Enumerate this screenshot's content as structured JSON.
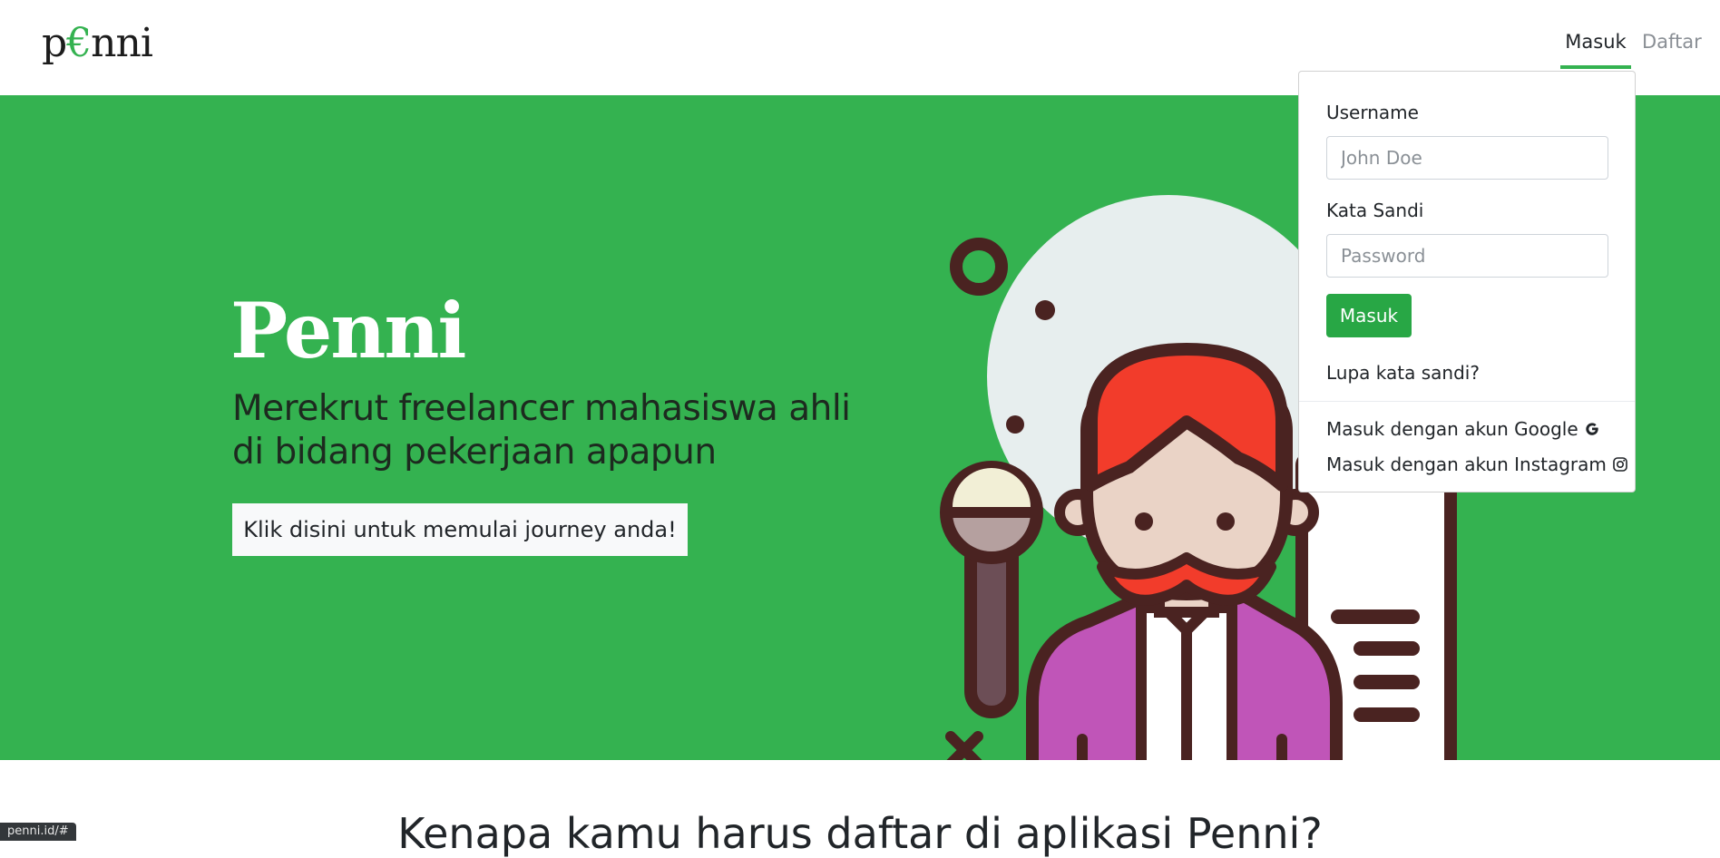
{
  "navbar": {
    "brand_prefix": "p",
    "brand_euro": "€",
    "brand_suffix": "nni",
    "login_label": "Masuk",
    "register_label": "Daftar",
    "accent_color": "#34b250"
  },
  "hero": {
    "title": "Penni",
    "subtitle": "Merekrut freelancer mahasiswa ahli di bidang pekerjaan apapun",
    "cta_label": "Klik disini untuk memulai journey anda!",
    "background_color": "#34b250"
  },
  "login_dropdown": {
    "username_label": "Username",
    "username_placeholder": "John Doe",
    "password_label": "Kata Sandi",
    "password_placeholder": "Password",
    "submit_label": "Masuk",
    "forgot_label": "Lupa kata sandi?",
    "google_label": "Masuk dengan akun Google",
    "instagram_label": "Masuk dengan akun Instagram",
    "google_icon": "google-icon",
    "instagram_icon": "instagram-icon"
  },
  "section": {
    "title": "Kenapa kamu harus daftar di aplikasi Penni?"
  },
  "status_bar": {
    "url": "penni.id/#"
  }
}
